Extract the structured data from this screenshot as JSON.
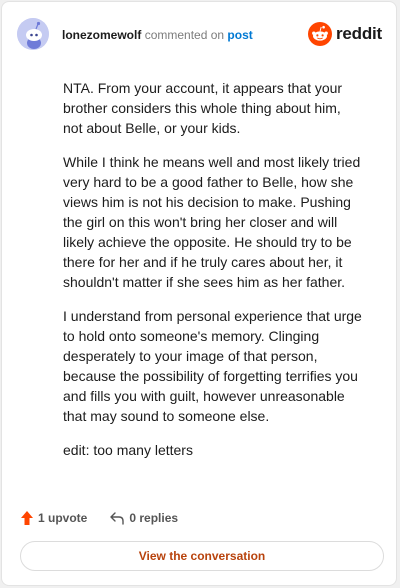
{
  "header": {
    "username": "lonezomewolf",
    "action_text": "commented on",
    "post_link": "post",
    "logo_text": "reddit",
    "logo_icon": "reddit-snoo-icon",
    "avatar_icon": "snoo-avatar-icon"
  },
  "comment": {
    "paragraphs": [
      "NTA. From your account, it appears that your brother considers this whole thing about him, not about Belle, or your kids.",
      "While I think he means well and most likely tried very hard to be a good father to Belle, how she views him is not his decision to make. Pushing the girl on this won't bring her closer and will likely achieve the opposite. He should try to be there for her and if he truly cares about her, it shouldn't matter if she sees him as her father.",
      "I understand from personal experience that urge to hold onto someone's memory. Clinging desperately to your image of that person, because the possibility of forgetting terrifies you and fills you with guilt, however unreasonable that may sound to someone else.",
      "edit: too many letters"
    ]
  },
  "actions": {
    "upvote_label": "1 upvote",
    "upvote_icon": "upvote-arrow-icon",
    "replies_label": "0 replies",
    "replies_icon": "reply-arrow-icon"
  },
  "footer": {
    "button_label": "View the conversation"
  },
  "colors": {
    "brand_orange": "#ff4500",
    "link_blue": "#0079d3",
    "button_text": "#b8430d"
  }
}
